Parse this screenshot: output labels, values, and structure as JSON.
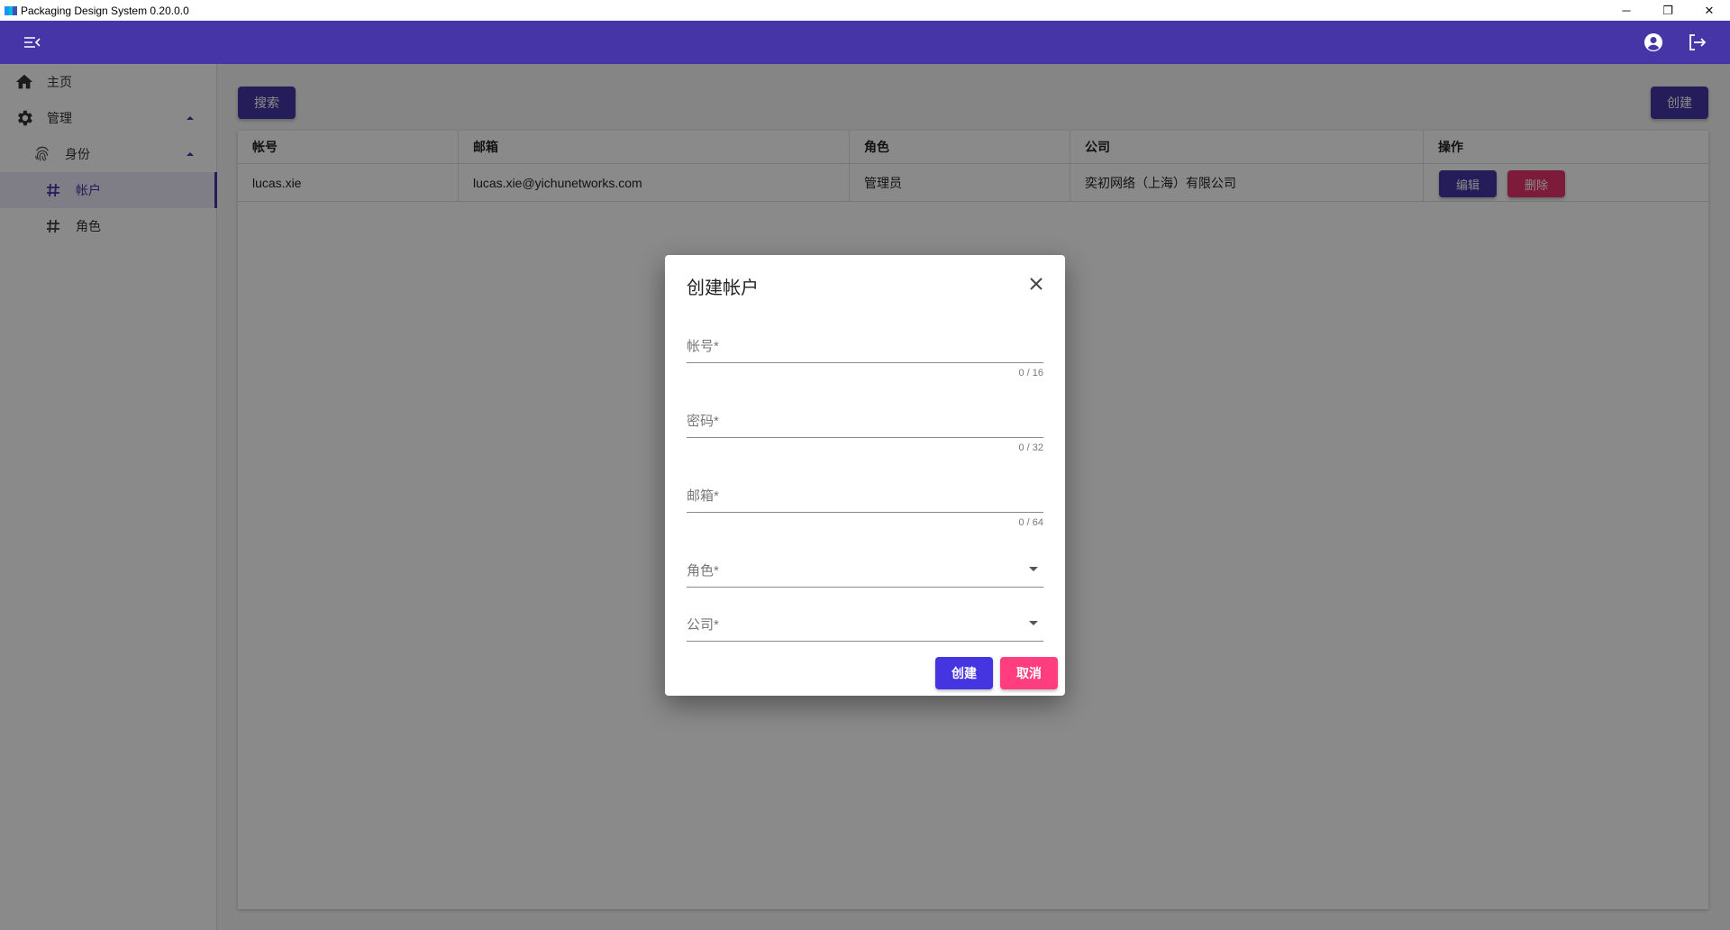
{
  "window": {
    "title": "Packaging Design System 0.20.0.0",
    "controls": {
      "minimize": "─",
      "restore": "❐",
      "close": "✕"
    }
  },
  "appbar": {
    "color": "#4535a6",
    "menu_toggle_icon": "menu-collapse-icon",
    "account_icon": "account-circle-icon",
    "logout_icon": "logout-icon"
  },
  "sidebar": {
    "items": [
      {
        "label": "主页",
        "icon": "home-icon"
      },
      {
        "label": "管理",
        "icon": "gear-icon",
        "expanded": true
      },
      {
        "label": "身份",
        "icon": "fingerprint-icon",
        "expanded": true
      },
      {
        "label": "帐户",
        "icon": "hash-icon",
        "active": true
      },
      {
        "label": "角色",
        "icon": "hash-icon"
      }
    ]
  },
  "toolbar": {
    "search_label": "搜索",
    "create_label": "创建"
  },
  "table": {
    "columns": [
      "帐号",
      "邮箱",
      "角色",
      "公司",
      "操作"
    ],
    "rows": [
      {
        "account": "lucas.xie",
        "email": "lucas.xie@yichunetworks.com",
        "role": "管理员",
        "company": "奕初网络（上海）有限公司",
        "edit_label": "编辑",
        "delete_label": "删除"
      }
    ]
  },
  "dialog": {
    "title": "创建帐户",
    "fields": {
      "account": {
        "label": "帐号*",
        "counter": "0 / 16"
      },
      "password": {
        "label": "密码*",
        "counter": "0 / 32"
      },
      "email": {
        "label": "邮箱*",
        "counter": "0 / 64"
      },
      "role": {
        "label": "角色*"
      },
      "company": {
        "label": "公司*"
      }
    },
    "create_label": "创建",
    "cancel_label": "取消",
    "create_color": "#4535e0",
    "cancel_color": "#ff3d7f"
  }
}
